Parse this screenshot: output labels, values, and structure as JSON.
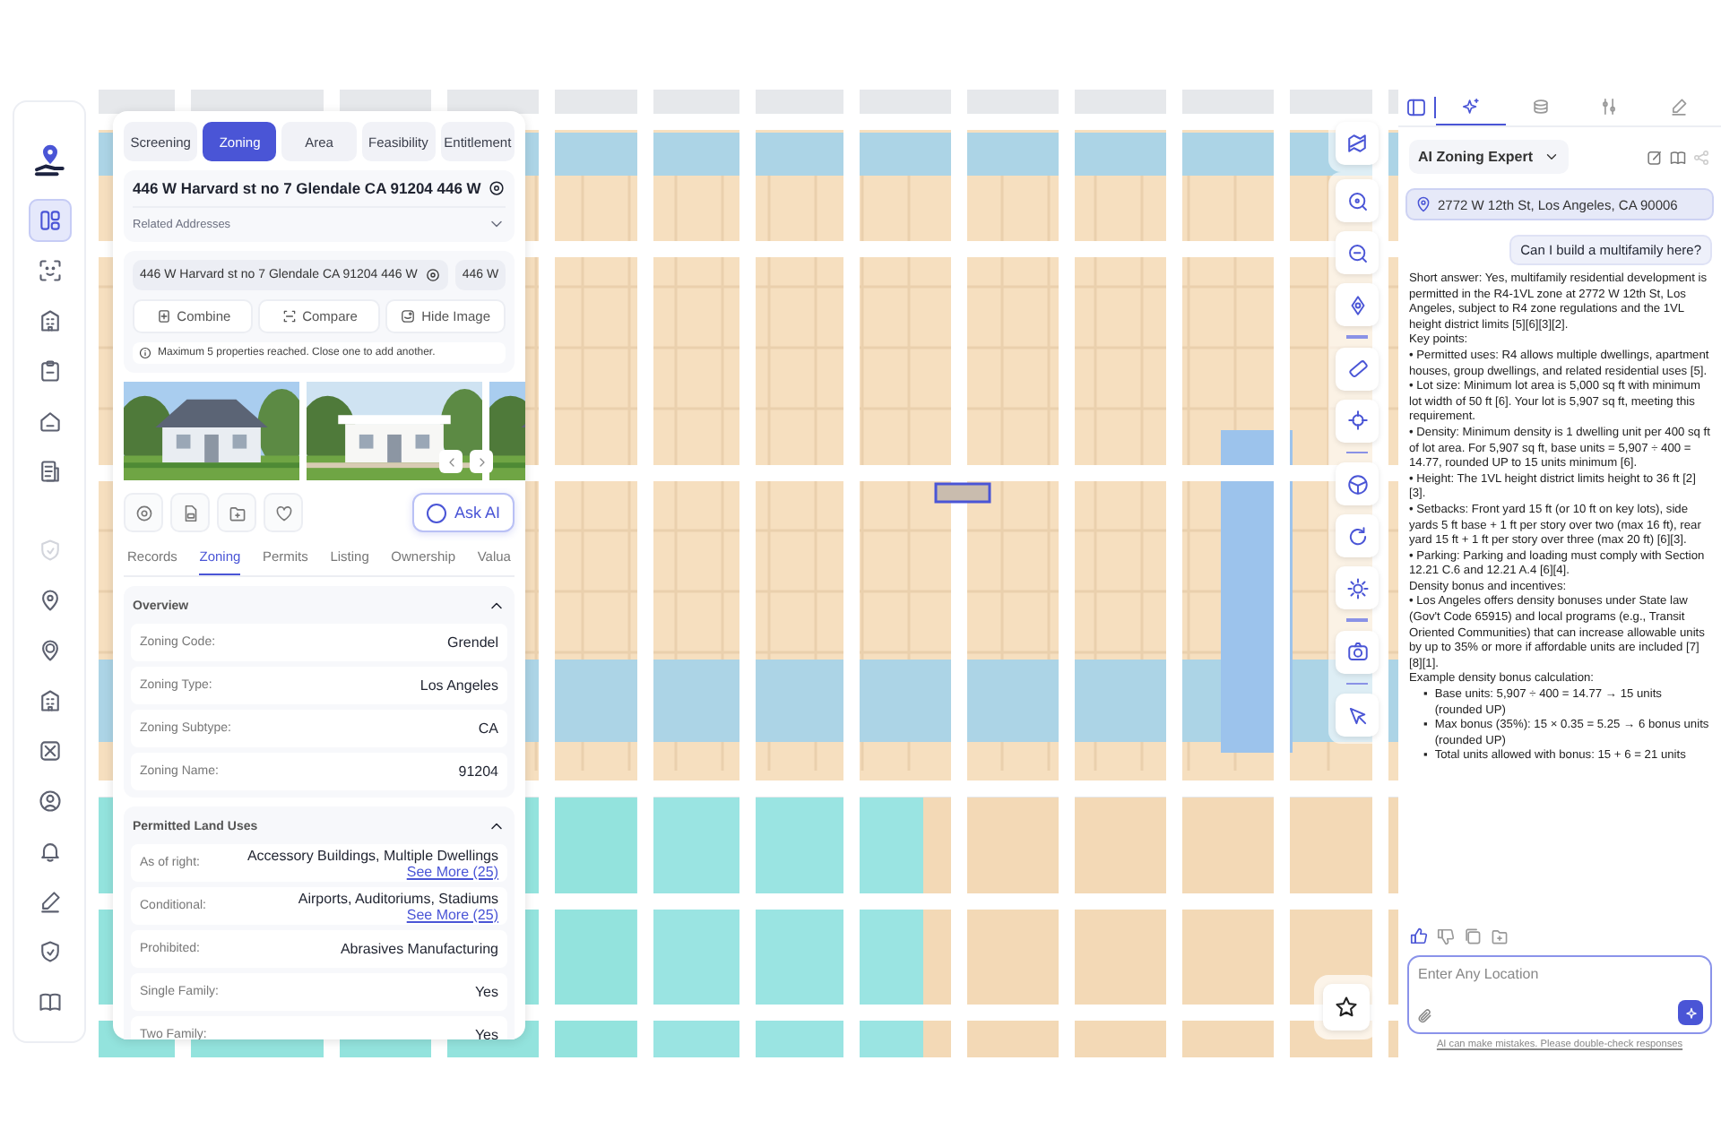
{
  "rail": {
    "items": [
      {
        "selected": true,
        "disabled": false
      },
      {
        "selected": false,
        "disabled": false
      },
      {
        "selected": false,
        "disabled": false
      },
      {
        "selected": false,
        "disabled": false
      },
      {
        "selected": false,
        "disabled": false
      },
      {
        "selected": false,
        "disabled": false
      },
      {
        "selected": false,
        "disabled": true
      },
      {
        "selected": false,
        "disabled": false
      },
      {
        "selected": false,
        "disabled": false
      },
      {
        "selected": false,
        "disabled": false
      },
      {
        "selected": false,
        "disabled": false
      },
      {
        "selected": false,
        "disabled": false
      },
      {
        "selected": false,
        "disabled": false
      },
      {
        "selected": false,
        "disabled": false
      },
      {
        "selected": false,
        "disabled": false
      },
      {
        "selected": false,
        "disabled": false
      }
    ]
  },
  "left_panel": {
    "tabs": [
      {
        "label": "Screening",
        "selected": false
      },
      {
        "label": "Zoning",
        "selected": true
      },
      {
        "label": "Area",
        "selected": false
      },
      {
        "label": "Feasibility",
        "selected": false
      },
      {
        "label": "Entitlement",
        "selected": false
      }
    ],
    "address": {
      "title": "446 W Harvard st no 7 Glendale CA 91204 446 W",
      "related_label": "Related Addresses",
      "expanded": false
    },
    "compare": {
      "chips": [
        "446 W Harvard st no 7 Glendale CA 91204 446 W",
        "446 W"
      ],
      "actions": [
        "Combine",
        "Compare",
        "Hide Image"
      ],
      "notice": "Maximum 5 properties reached. Close one to add another."
    },
    "ask_ai": "Ask AI",
    "detail_tabs": [
      {
        "label": "Records",
        "selected": false
      },
      {
        "label": "Zoning",
        "selected": true
      },
      {
        "label": "Permits",
        "selected": false
      },
      {
        "label": "Listing",
        "selected": false
      },
      {
        "label": "Ownership",
        "selected": false
      },
      {
        "label": "Valua",
        "selected": false
      }
    ],
    "sections": [
      {
        "title": "Overview",
        "expanded": true,
        "rows": [
          {
            "label": "Zoning Code:",
            "value": "Grendel"
          },
          {
            "label": "Zoning Type:",
            "value": "Los Angeles"
          },
          {
            "label": "Zoning Subtype:",
            "value": "CA"
          },
          {
            "label": "Zoning Name:",
            "value": "91204"
          }
        ]
      },
      {
        "title": "Permitted Land Uses",
        "expanded": true,
        "rows": [
          {
            "label": "As of right:",
            "value": "Accessory Buildings, Multiple Dwellings",
            "link": "See More (25)"
          },
          {
            "label": "Conditional:",
            "value": "Airports, Auditoriums, Stadiums",
            "link": "See More (25)"
          },
          {
            "label": "Prohibited:",
            "value": "Abrasives Manufacturing"
          },
          {
            "label": "Single Family:",
            "value": "Yes"
          },
          {
            "label": "Two Family:",
            "value": "Yes"
          }
        ]
      }
    ]
  },
  "right_panel": {
    "tabs": [
      {
        "selected": true
      },
      {
        "selected": false
      },
      {
        "selected": false
      },
      {
        "selected": false
      }
    ],
    "assistant": "AI Zoning Expert",
    "location": "2772 W 12th St, Los Angeles, CA 90006",
    "question": "Can I build a multifamily here?",
    "answer": [
      {
        "kind": "text",
        "text": "Short answer: Yes, multifamily residential development is permitted in the R4-1VL zone at 2772 W 12th St, Los Angeles, subject to R4 zone regulations and the 1VL height district limits [5][6][3][2]."
      },
      {
        "kind": "text",
        "text": "Key points:"
      },
      {
        "kind": "text",
        "text": "• Permitted uses: R4 allows multiple dwellings, apartment houses, group dwellings, and related residential uses [5]."
      },
      {
        "kind": "text",
        "text": "• Lot size: Minimum lot area is 5,000 sq ft with minimum lot width of 50 ft [6]. Your lot is 5,907 sq ft, meeting this requirement."
      },
      {
        "kind": "text",
        "text": "• Density: Minimum density is 1 dwelling unit per 400 sq ft of lot area. For 5,907 sq ft, base units = 5,907 ÷ 400 = 14.77, rounded UP to 15 units minimum [6]."
      },
      {
        "kind": "text",
        "text": "• Height: The 1VL height district limits height to 36 ft [2][3]."
      },
      {
        "kind": "text",
        "text": "• Setbacks: Front yard 15 ft (or 10 ft on key lots), side yards 5 ft base + 1 ft per story over two (max 16 ft), rear yard 15 ft + 1 ft per story over three (max 20 ft) [6][3]."
      },
      {
        "kind": "text",
        "text": "• Parking: Parking and loading must comply with Section 12.21 C.6 and 12.21 A.4 [6][4]."
      },
      {
        "kind": "text",
        "text": "Density bonus and incentives:"
      },
      {
        "kind": "text",
        "text": "• Los Angeles offers density bonuses under State law (Gov't Code 65915) and local programs (e.g., Transit Oriented Communities) that can increase allowable units by up to 35% or more if affordable units are included [7][8][1]."
      },
      {
        "kind": "text",
        "text": "Example density bonus calculation:"
      },
      {
        "kind": "subitem",
        "bullet": "▪",
        "text": "Base units: 5,907 ÷ 400 = 14.77 → 15 units (rounded UP)"
      },
      {
        "kind": "subitem",
        "bullet": "▪",
        "text": "Max bonus (35%): 15 × 0.35 = 5.25 → 6 bonus units (rounded UP)"
      },
      {
        "kind": "subitem",
        "bullet": "▪",
        "text": "Total units allowed with bonus: 15 + 6 = 21 units"
      }
    ],
    "liked": true,
    "input": {
      "placeholder": "Enter Any Location"
    },
    "disclaimer": "AI can make mistakes. Please double-check responses"
  }
}
